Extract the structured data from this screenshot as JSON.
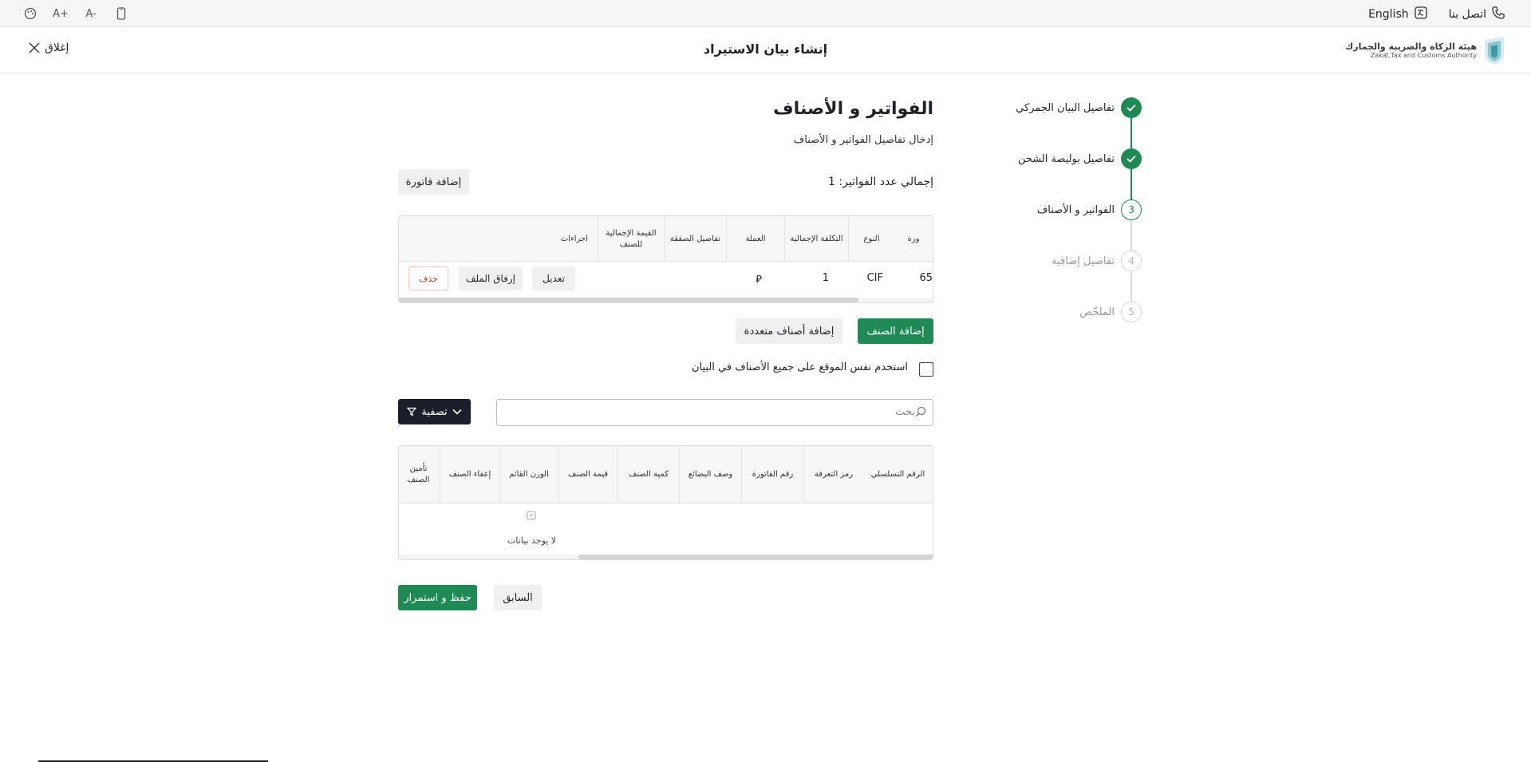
{
  "utility": {
    "contact": "اتصل بنا",
    "language": "English",
    "font_increase": "A+",
    "font_decrease": "A-"
  },
  "header": {
    "title": "إنشاء بيان الاستيراد",
    "close": "إغلاق",
    "logo_ar": "هيئة الزكاة والضريبة والجمارك",
    "logo_en": "Zakat,Tax and Customs Authority"
  },
  "stepper": {
    "steps": [
      {
        "label": "تفاصيل البيان الجمركي",
        "state": "done",
        "number": "1"
      },
      {
        "label": "تفاصيل بوليصة الشحن",
        "state": "done",
        "number": "2"
      },
      {
        "label": "الفواتير و الأصناف",
        "state": "active",
        "number": "3"
      },
      {
        "label": "تفاصيل إضافية",
        "state": "pending",
        "number": "4"
      },
      {
        "label": "الملخّص",
        "state": "pending",
        "number": "5"
      }
    ]
  },
  "section": {
    "title": "الفواتير و الأصناف",
    "subtitle": "إدخال تفاصيل الفواتير و الأصناف",
    "invoice_count": "إجمالي عدد الفواتير: 1",
    "add_invoice": "إضافة فاتورة"
  },
  "invoices_table": {
    "headers": [
      "ورة",
      "النوع",
      "التكلفة الإجمالية",
      "العملة",
      "تفاصيل الصفقة",
      "القيمة الإجمالية للصنف",
      "اجراءات"
    ],
    "row": {
      "number": "65",
      "type": "CIF",
      "total_cost": "1",
      "currency": "⃁",
      "edit": "تعديل",
      "attach": "إرفاق الملف",
      "delete": "حذف"
    }
  },
  "items": {
    "add_item": "إضافة الصنف",
    "add_multiple": "إضافة أصناف متعددة",
    "same_location": "استخدم نفس الموقع على جميع الأصناف في البيان",
    "search_placeholder": "بحث",
    "filter": "تصفية"
  },
  "items_table": {
    "headers": [
      "الرقم التسلسلي",
      "رمز التعرفة",
      "رقم الفاتورة",
      "وصف البضائع",
      "كمية الصنف",
      "قيمة الصنف",
      "الوزن القائم",
      "إعفاء الصنف",
      "تأمين الصنف"
    ],
    "empty": "لا يوجد بيانات"
  },
  "footer": {
    "previous": "السابق",
    "save_continue": "حفظ و استمرار"
  },
  "colors": {
    "accent_green": "#1f8a55",
    "dark": "#1a1f2b",
    "pending_gray": "#cfcfcf"
  }
}
